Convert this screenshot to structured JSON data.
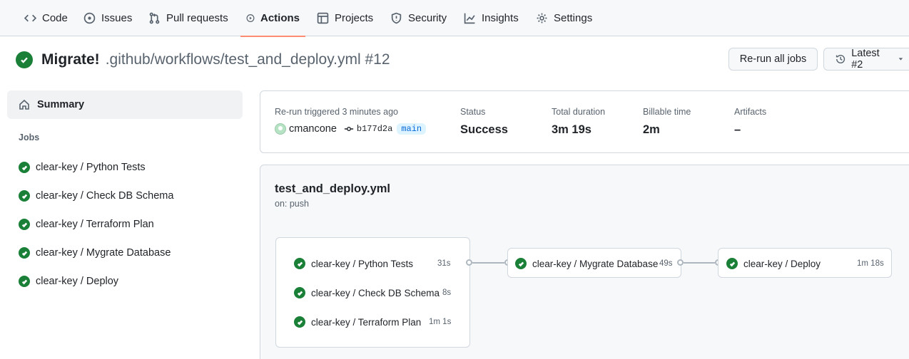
{
  "nav": {
    "tabs": [
      {
        "label": "Code",
        "icon": "code-icon"
      },
      {
        "label": "Issues",
        "icon": "issue-opened-icon"
      },
      {
        "label": "Pull requests",
        "icon": "git-pull-request-icon"
      },
      {
        "label": "Actions",
        "icon": "play-icon",
        "active": true
      },
      {
        "label": "Projects",
        "icon": "table-icon"
      },
      {
        "label": "Security",
        "icon": "shield-icon"
      },
      {
        "label": "Insights",
        "icon": "graph-icon"
      },
      {
        "label": "Settings",
        "icon": "gear-icon"
      }
    ]
  },
  "run": {
    "title": "Migrate!",
    "path": ".github/workflows/test_and_deploy.yml #12",
    "status_icon": "check-circle-fill-icon",
    "rerun_label": "Re-run all jobs",
    "attempt_label": "Latest #2"
  },
  "sidebar": {
    "summary_label": "Summary",
    "jobs_heading": "Jobs",
    "jobs": [
      "clear-key / Python Tests",
      "clear-key / Check DB Schema",
      "clear-key / Terraform Plan",
      "clear-key / Mygrate Database",
      "clear-key / Deploy"
    ]
  },
  "summary": {
    "trigger_label": "Re-run triggered 3 minutes ago",
    "actor": "cmancone",
    "commit": "b177d2a",
    "branch": "main",
    "status_label": "Status",
    "status_value": "Success",
    "duration_label": "Total duration",
    "duration_value": "3m 19s",
    "billable_label": "Billable time",
    "billable_value": "2m",
    "artifacts_label": "Artifacts",
    "artifacts_value": "–"
  },
  "workflow": {
    "file": "test_and_deploy.yml",
    "trigger": "on: push",
    "stage1": [
      {
        "name": "clear-key / Python Tests",
        "duration": "31s"
      },
      {
        "name": "clear-key / Check DB Schema",
        "duration": "8s"
      },
      {
        "name": "clear-key / Terraform Plan",
        "duration": "1m 1s"
      }
    ],
    "stage2": {
      "name": "clear-key / Mygrate Database",
      "duration": "49s"
    },
    "stage3": {
      "name": "clear-key / Deploy",
      "duration": "1m 18s"
    }
  },
  "colors": {
    "success": "#1a7f37",
    "active_tab_underline": "#fd8c73",
    "branch_text": "#0969da",
    "branch_bg": "#ddf4ff"
  }
}
